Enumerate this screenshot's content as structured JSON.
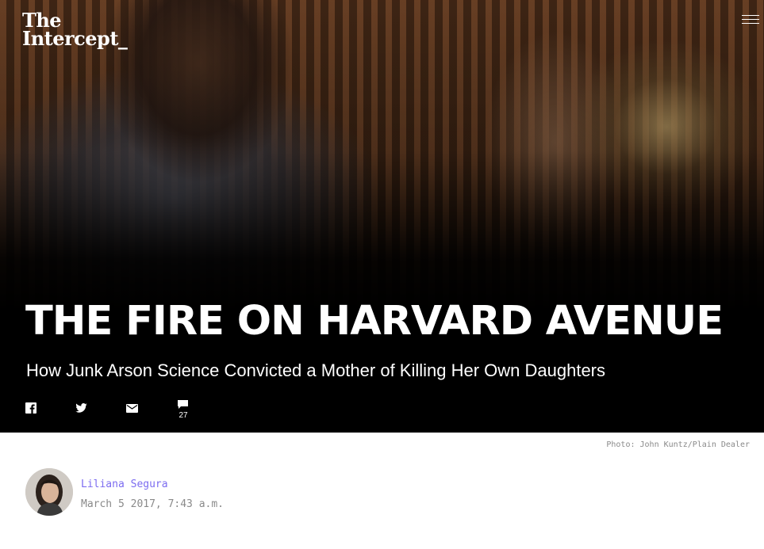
{
  "site": {
    "logo_line1": "The",
    "logo_line2": "Intercept_"
  },
  "header": {
    "menu_icon": "hamburger-menu-icon"
  },
  "article": {
    "headline": "THE FIRE ON HARVARD AVENUE",
    "dek": "How Junk Arson Science Convicted a Mother of Killing Her Own Daughters",
    "photo_credit": "Photo: John Kuntz/Plain Dealer",
    "author": "Liliana Segura",
    "date": "March 5 2017, 7:43 a.m."
  },
  "share": {
    "items": [
      {
        "name": "facebook",
        "icon": "facebook-icon"
      },
      {
        "name": "twitter",
        "icon": "twitter-icon"
      },
      {
        "name": "email",
        "icon": "email-icon"
      },
      {
        "name": "comments",
        "icon": "comment-icon"
      }
    ],
    "comment_count": "27"
  },
  "colors": {
    "author_link": "#7c6cf0",
    "meta_text": "#8a8a8a",
    "hero_bg": "#000000",
    "page_bg": "#ffffff"
  }
}
